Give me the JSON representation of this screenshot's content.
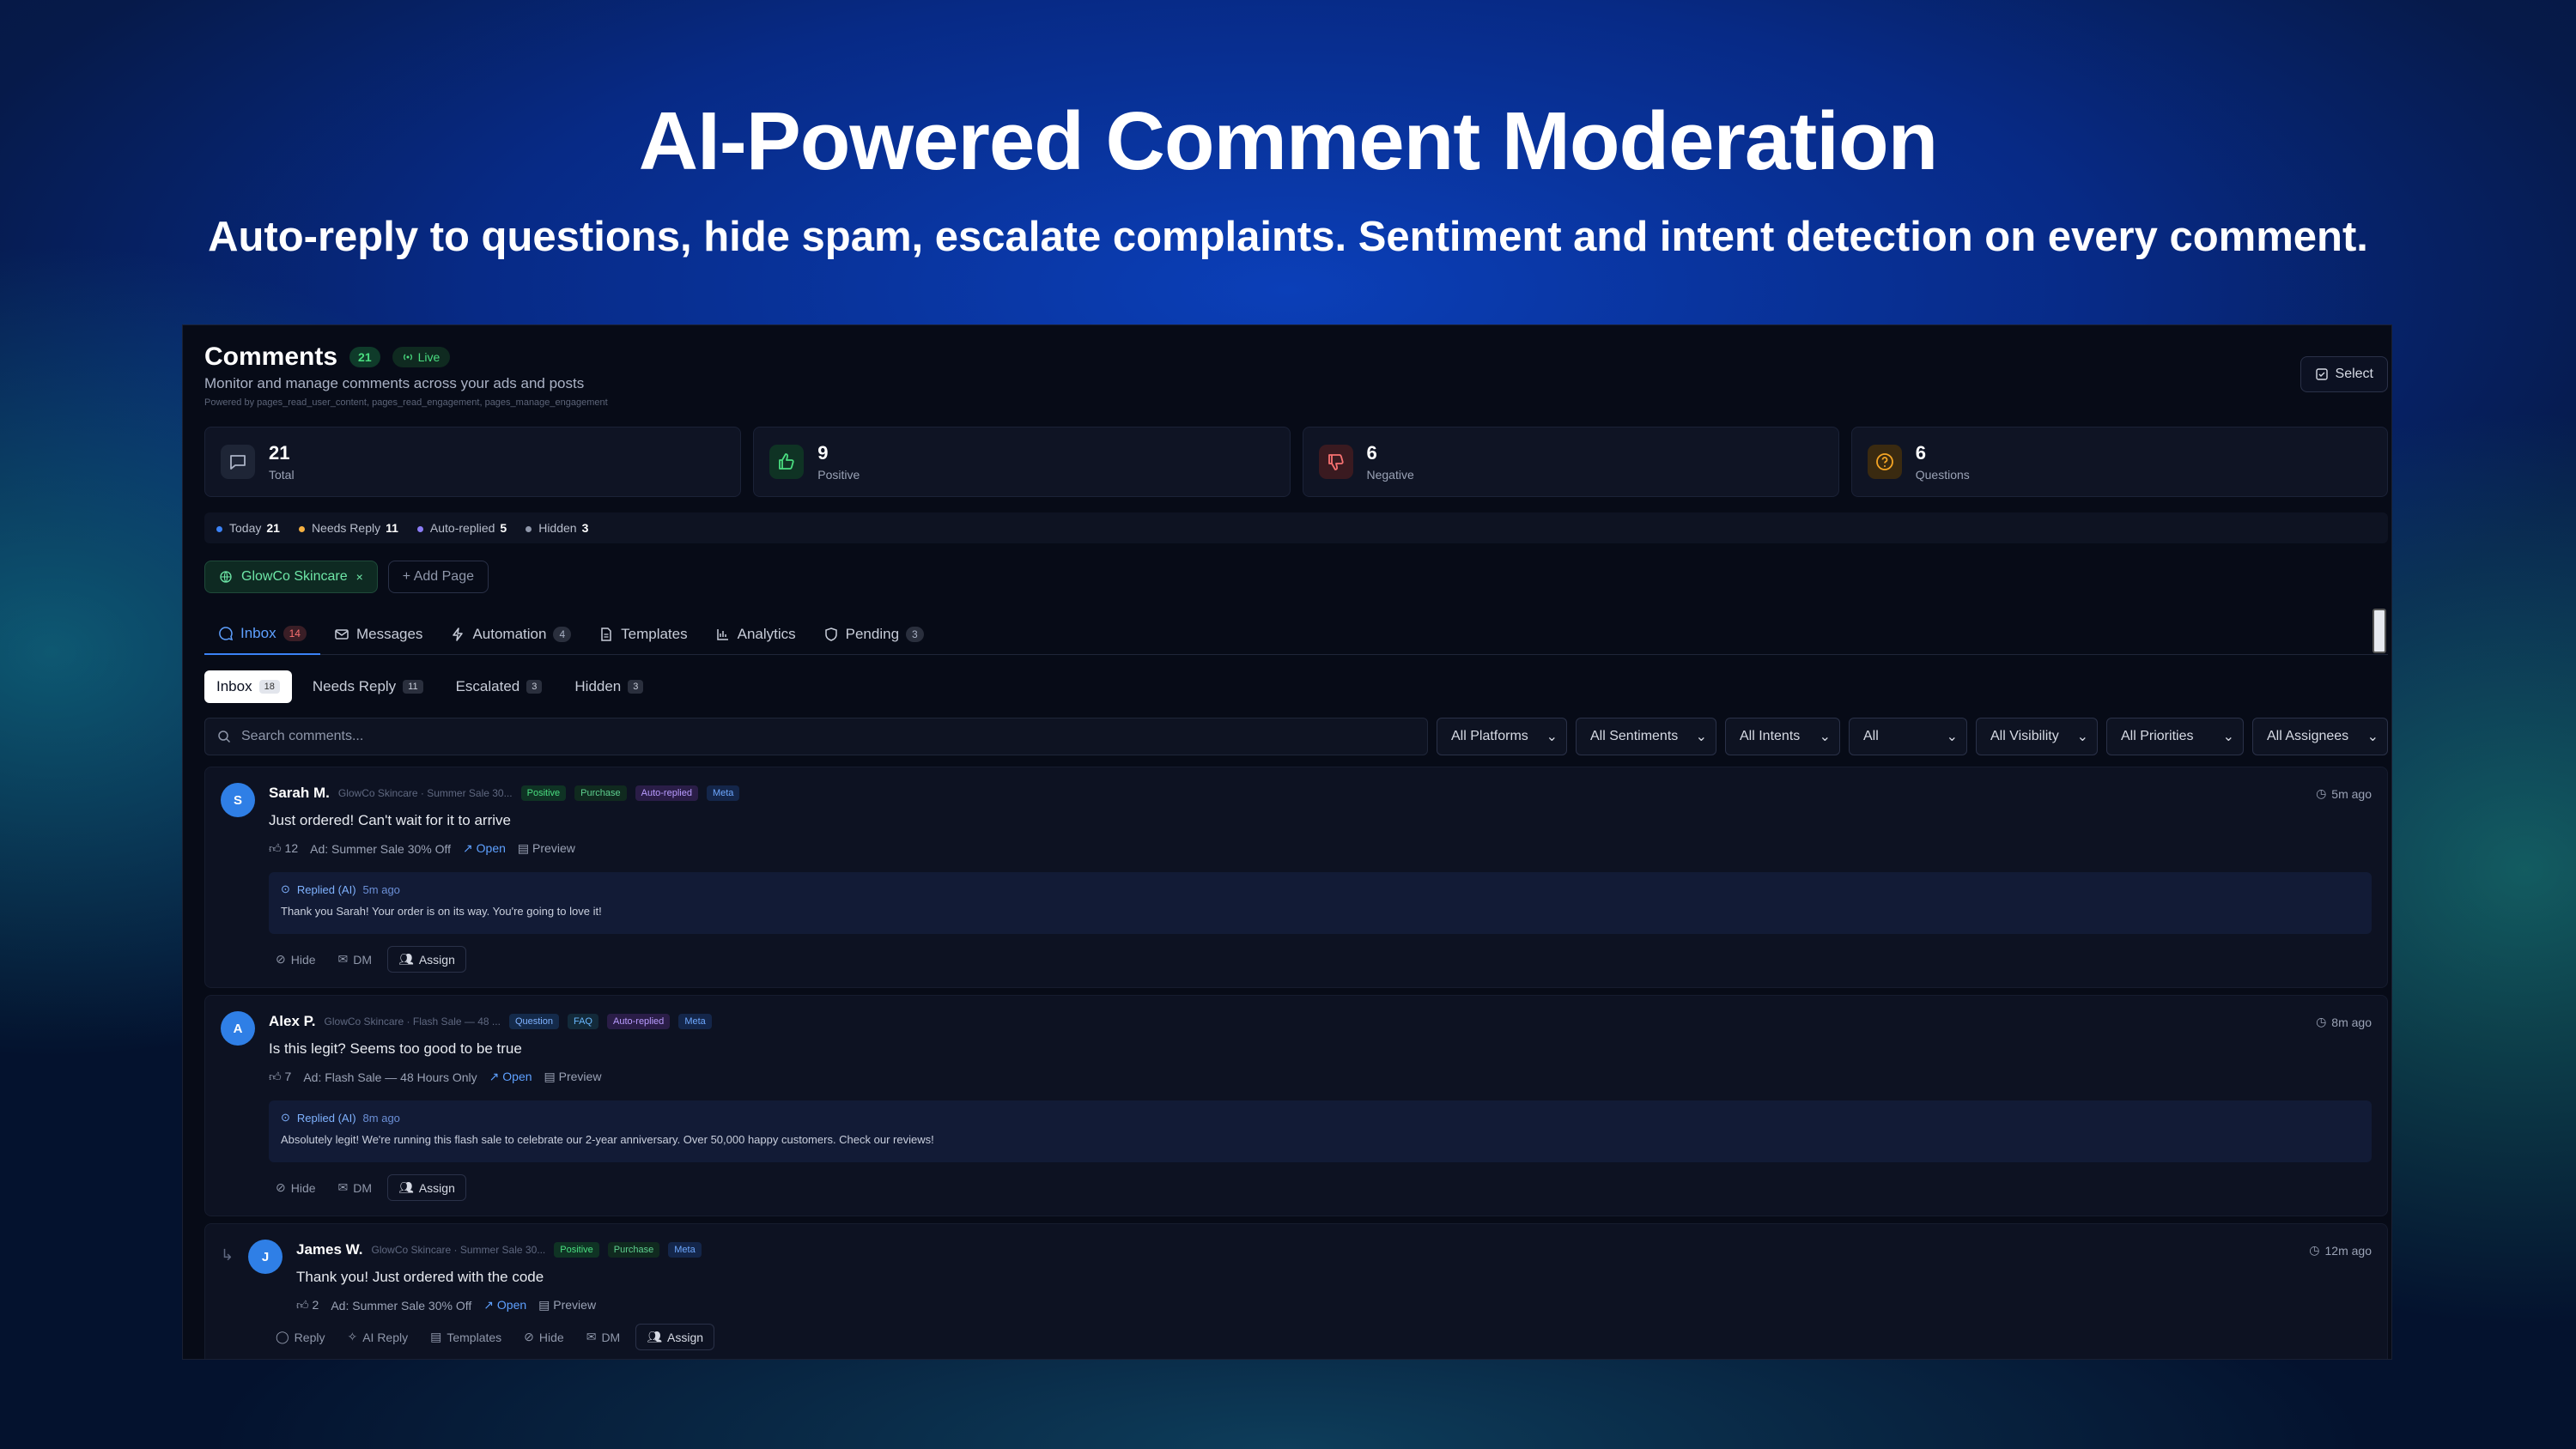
{
  "hero": {
    "title": "AI-Powered Comment Moderation",
    "subtitle": "Auto-reply to questions, hide spam, escalate complaints. Sentiment and intent detection on every comment."
  },
  "header": {
    "title": "Comments",
    "count": "21",
    "live": "Live",
    "subtitle": "Monitor and manage comments across your ads and posts",
    "powered": "Powered by pages_read_user_content, pages_read_engagement, pages_manage_engagement",
    "select_label": "Select"
  },
  "stats": [
    {
      "value": "21",
      "label": "Total"
    },
    {
      "value": "9",
      "label": "Positive"
    },
    {
      "value": "6",
      "label": "Negative"
    },
    {
      "value": "6",
      "label": "Questions"
    }
  ],
  "today": [
    {
      "label": "Today",
      "value": "21",
      "color": "#3b82f6"
    },
    {
      "label": "Needs Reply",
      "value": "11",
      "color": "#f5b041"
    },
    {
      "label": "Auto-replied",
      "value": "5",
      "color": "#8b7cf6"
    },
    {
      "label": "Hidden",
      "value": "3",
      "color": "#8f97aa"
    }
  ],
  "pages": {
    "active": "GlowCo Skincare",
    "add": "+ Add Page"
  },
  "tabs": [
    {
      "label": "Inbox",
      "count": "14"
    },
    {
      "label": "Messages"
    },
    {
      "label": "Automation",
      "count": "4"
    },
    {
      "label": "Templates"
    },
    {
      "label": "Analytics"
    },
    {
      "label": "Pending",
      "count": "3"
    }
  ],
  "subtabs": [
    {
      "label": "Inbox",
      "count": "18"
    },
    {
      "label": "Needs Reply",
      "count": "11"
    },
    {
      "label": "Escalated",
      "count": "3"
    },
    {
      "label": "Hidden",
      "count": "3"
    }
  ],
  "search": {
    "placeholder": "Search comments..."
  },
  "filters": [
    "All Platforms",
    "All Sentiments",
    "All Intents",
    "All",
    "All Visibility",
    "All Priorities",
    "All Assignees"
  ],
  "comments": [
    {
      "initial": "S",
      "name": "Sarah M.",
      "source": "GlowCo Skincare · Summer Sale 30...",
      "tags": [
        "Positive",
        "Purchase",
        "Auto-replied",
        "Meta"
      ],
      "text": "Just ordered! Can't wait for it to arrive",
      "likes": "12",
      "ad": "Ad: Summer Sale 30% Off",
      "open": "Open",
      "preview": "Preview",
      "time": "5m ago",
      "reply_label": "Replied (AI)",
      "reply_time": "5m ago",
      "reply_text": "Thank you Sarah! Your order is on its way. You're going to love it!",
      "actions": [
        "Hide",
        "DM",
        "Assign"
      ]
    },
    {
      "initial": "A",
      "name": "Alex P.",
      "source": "GlowCo Skincare · Flash Sale — 48 ...",
      "tags": [
        "Question",
        "FAQ",
        "Auto-replied",
        "Meta"
      ],
      "text": "Is this legit? Seems too good to be true",
      "likes": "7",
      "ad": "Ad: Flash Sale — 48 Hours Only",
      "open": "Open",
      "preview": "Preview",
      "time": "8m ago",
      "reply_label": "Replied (AI)",
      "reply_time": "8m ago",
      "reply_text": "Absolutely legit! We're running this flash sale to celebrate our 2-year anniversary. Over 50,000 happy customers. Check our reviews!",
      "actions": [
        "Hide",
        "DM",
        "Assign"
      ]
    },
    {
      "initial": "J",
      "name": "James W.",
      "source": "GlowCo Skincare · Summer Sale 30...",
      "tags": [
        "Positive",
        "Purchase",
        "Meta"
      ],
      "text": "Thank you! Just ordered with the code",
      "likes": "2",
      "ad": "Ad: Summer Sale 30% Off",
      "open": "Open",
      "preview": "Preview",
      "time": "12m ago",
      "actions": [
        "Reply",
        "AI Reply",
        "Templates",
        "Hide",
        "DM",
        "Assign"
      ]
    }
  ],
  "colors": {
    "accent": "#3b82f6",
    "positive": "#4ade80",
    "negative": "#f87171",
    "question": "#f5a524"
  }
}
